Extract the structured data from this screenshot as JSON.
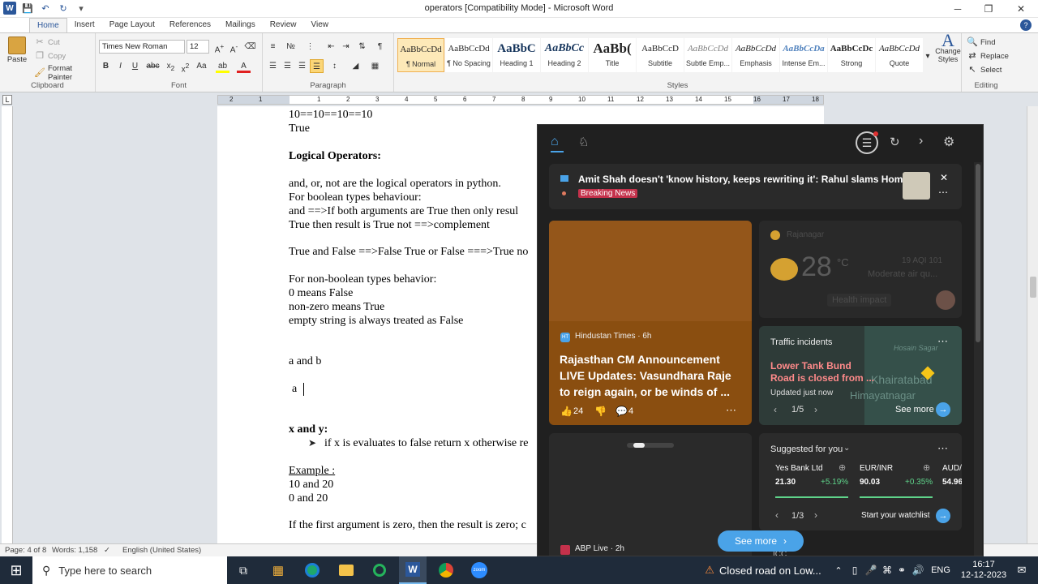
{
  "window": {
    "title": "operators [Compatibility Mode] - Microsoft Word",
    "minimize": "─",
    "maximize": "❐",
    "close": "✕"
  },
  "ribbon_tabs": [
    "Home",
    "Insert",
    "Page Layout",
    "References",
    "Mailings",
    "Review",
    "View"
  ],
  "clipboard": {
    "paste": "Paste",
    "cut": "Cut",
    "copy": "Copy",
    "format_painter": "Format Painter",
    "label": "Clipboard"
  },
  "font": {
    "name": "Times New Roman",
    "size": "12",
    "label": "Font"
  },
  "paragraph": {
    "label": "Paragraph"
  },
  "styles": {
    "label": "Styles",
    "items": [
      {
        "preview": "AaBbCcDd",
        "name": "¶ Normal"
      },
      {
        "preview": "AaBbCcDd",
        "name": "¶ No Spacing"
      },
      {
        "preview": "AaBbC",
        "name": "Heading 1"
      },
      {
        "preview": "AaBbCc",
        "name": "Heading 2"
      },
      {
        "preview": "AaBb(",
        "name": "Title"
      },
      {
        "preview": "AaBbCcD",
        "name": "Subtitle"
      },
      {
        "preview": "AaBbCcDd",
        "name": "Subtle Emp..."
      },
      {
        "preview": "AaBbCcDd",
        "name": "Emphasis"
      },
      {
        "preview": "AaBbCcDa",
        "name": "Intense Em..."
      },
      {
        "preview": "AaBbCcDc",
        "name": "Strong"
      },
      {
        "preview": "AaBbCcDd",
        "name": "Quote"
      }
    ],
    "change_styles": "Change Styles"
  },
  "editing": {
    "find": "Find",
    "replace": "Replace",
    "select": "Select",
    "label": "Editing"
  },
  "ruler_numbers": [
    "2",
    "1",
    "1",
    "2",
    "3",
    "4",
    "5",
    "6",
    "7",
    "8",
    "9",
    "10",
    "11",
    "12",
    "13",
    "14",
    "15",
    "16",
    "17",
    "18",
    "19"
  ],
  "document": {
    "lines": [
      "10==10==10==10",
      "True",
      "Logical Operators:",
      "and, or, not are the logical operators in python.",
      "For boolean types behaviour:",
      "and ==>If both arguments are True then only resul",
      "True then result is True not ==>complement",
      "True and False ==>False True or False ===>True no",
      "For non-boolean types behavior:",
      "0 means False",
      "non-zero means True",
      "empty string is always treated as False",
      "a  and  b",
      "a",
      "x and y:",
      "if x is evaluates to false return x otherwise re",
      "Example :",
      "10 and 20",
      "0 and 20",
      "If the first argument is zero, then the result is zero; c"
    ]
  },
  "status": {
    "page": "Page: 4 of 8",
    "words": "Words: 1,158",
    "language": "English (United States)"
  },
  "taskbar": {
    "search_placeholder": "Type here to search",
    "news_ticker": "Closed road on Low...",
    "lang": "ENG",
    "time": "16:17",
    "date": "12-12-2023"
  },
  "widgets": {
    "breaking": {
      "headline": "Amit Shah doesn't 'know history, keeps rewriting it': Rahul slams Home ...",
      "badge": "Breaking News"
    },
    "weather": {
      "location": "Rajanagar",
      "temp": "28",
      "unit": "°C",
      "aqi": "19 AQI 101",
      "air": "Moderate air qu...",
      "health": "Health impact"
    },
    "news_card": {
      "source": "Hindustan Times · 6h",
      "headline": "Rajasthan CM Announcement LIVE Updates: Vasundhara Raje to reign again, or be winds of ...",
      "likes": "24",
      "comments": "4"
    },
    "traffic": {
      "title": "Traffic incidents",
      "headline": "Lower Tank Bund Road is closed from ...",
      "updated": "Updated just now",
      "pager": "1/5",
      "see_more": "See more",
      "map_label1": "Hosain Sagar",
      "map_label2": "Khairatabad",
      "map_label3": "Himayatnagar"
    },
    "abp": {
      "source": "ABP Live · 2h"
    },
    "suggested": {
      "title": "Suggested for you",
      "stocks": [
        {
          "name": "Yes Bank Ltd",
          "price": "21.30",
          "change": "+5.19%"
        },
        {
          "name": "EUR/INR",
          "price": "90.03",
          "change": "+0.35%"
        },
        {
          "name": "AUD/",
          "price": "54.96",
          "change": ""
        }
      ],
      "pager": "1/3",
      "watchlist": "Start your watchlist"
    },
    "see_more": "See more",
    "bottom": "ICC"
  },
  "colors": {
    "word_blue": "#2b579a",
    "news_card_bg": "#8a4e10",
    "breaking_red": "#c4314b",
    "stock_green": "#5fd38a",
    "see_more_blue": "#4aa3e8",
    "traffic_red": "#ff8a8a"
  }
}
